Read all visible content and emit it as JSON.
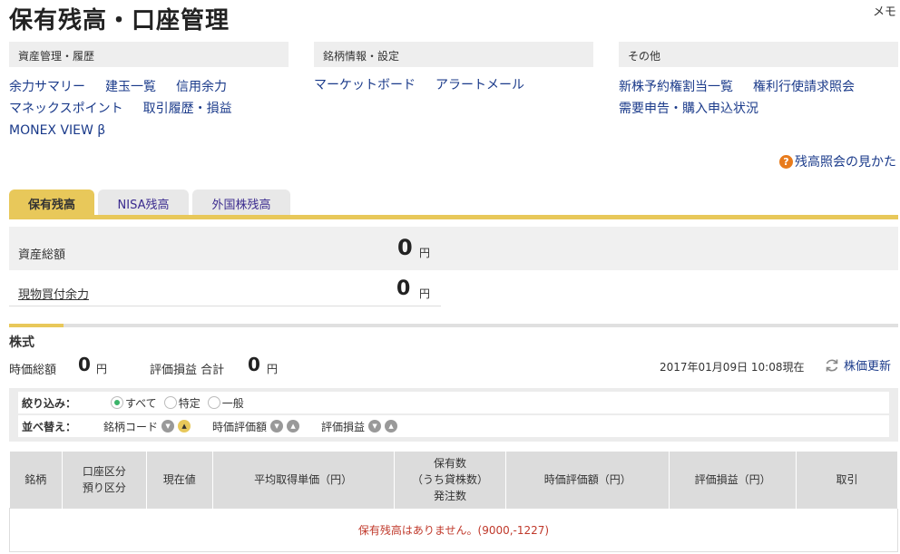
{
  "header": {
    "title": "保有残高・口座管理",
    "memo": "メモ"
  },
  "categories": [
    {
      "title": "資産管理・履歴",
      "links": [
        [
          "余力サマリー",
          "建玉一覧",
          "信用余力"
        ],
        [
          "マネックスポイント",
          "取引履歴・損益"
        ],
        [
          "MONEX VIEW β"
        ]
      ]
    },
    {
      "title": "銘柄情報・設定",
      "links": [
        [
          "マーケットボード",
          "アラートメール"
        ]
      ]
    },
    {
      "title": "その他",
      "links": [
        [
          "新株予約権割当一覧",
          "権利行使請求照会"
        ],
        [
          "需要申告・購入申込状況"
        ]
      ]
    }
  ],
  "help": {
    "icon": "?",
    "label": "残高照会の見かた"
  },
  "tabs": [
    "保有残高",
    "NISA残高",
    "外国株残高"
  ],
  "summary": {
    "total_label": "資産総額",
    "total_value": "0",
    "total_unit": "円",
    "cash_label": "現物買付余力",
    "cash_value": "0",
    "cash_unit": "円"
  },
  "stock": {
    "heading": "株式",
    "mv_label": "時価総額",
    "mv_value": "0",
    "mv_unit": "円",
    "pl_label": "評価損益 合計",
    "pl_value": "0",
    "pl_unit": "円",
    "timestamp": "2017年01月09日 10:08現在",
    "refresh": "株価更新"
  },
  "filter": {
    "label": "絞り込み：",
    "options": [
      "すべて",
      "特定",
      "一般"
    ],
    "selected": "すべて",
    "sort_label": "並べ替え：",
    "sort_keys": [
      "銘柄コード",
      "時価評価額",
      "評価損益"
    ]
  },
  "table": {
    "headers": [
      "銘柄",
      "口座区分\n預り区分",
      "現在値",
      "平均取得単価（円）",
      "保有数\n（うち貸株数）\n発注数",
      "時価評価額（円）",
      "評価損益（円）",
      "取引"
    ],
    "empty_message": "保有残高はありません。(9000,-1227)"
  },
  "colors": {
    "accent": "#e8c85a",
    "link": "#1a3a8a",
    "error": "#c0392b",
    "help_icon": "#e87b1c"
  }
}
